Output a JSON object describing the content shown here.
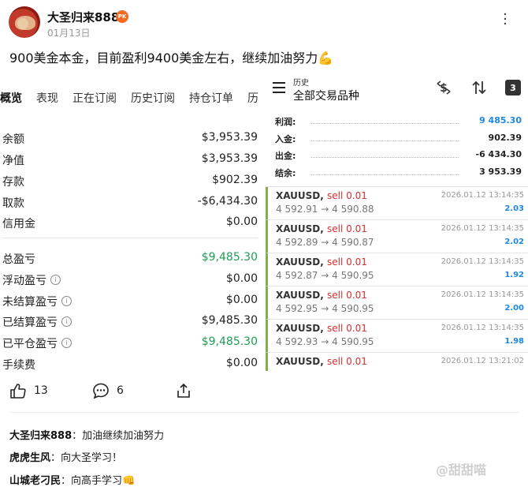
{
  "post": {
    "username": "大圣归来888",
    "badge": "PK",
    "date": "01月13日",
    "caption": "900美金本金，目前盈利9400美金左右，继续加油努力💪"
  },
  "left": {
    "tabs": [
      "概览",
      "表现",
      "正在订阅",
      "历史订阅",
      "持仓订单",
      "历"
    ],
    "rows": [
      {
        "label": "余额",
        "value": "$3,953.39",
        "info": false,
        "green": false
      },
      {
        "label": "净值",
        "value": "$3,953.39",
        "info": false,
        "green": false
      },
      {
        "label": "存款",
        "value": "$902.39",
        "info": false,
        "green": false
      },
      {
        "label": "取款",
        "value": "-$6,434.30",
        "info": false,
        "green": false
      },
      {
        "label": "信用金",
        "value": "$0.00",
        "info": false,
        "green": false
      },
      {
        "label": "总盈亏",
        "value": "$9,485.30",
        "info": false,
        "green": true
      },
      {
        "label": "浮动盈亏",
        "value": "$0.00",
        "info": true,
        "green": false
      },
      {
        "label": "未结算盈亏",
        "value": "$0.00",
        "info": true,
        "green": false
      },
      {
        "label": "已结算盈亏",
        "value": "$9,485.30",
        "info": true,
        "green": false
      },
      {
        "label": "已平仓盈亏",
        "value": "$9,485.30",
        "info": true,
        "green": true
      },
      {
        "label": "手续费",
        "value": "$0.00",
        "info": false,
        "green": false
      }
    ]
  },
  "right": {
    "subtitle": "历史",
    "title": "全部交易品种",
    "calendar_day": "3",
    "summary": [
      {
        "label": "利润:",
        "value": "9 485.30",
        "blue": true
      },
      {
        "label": "入金:",
        "value": "902.39",
        "blue": false
      },
      {
        "label": "出金:",
        "value": "-6 434.30",
        "blue": false
      },
      {
        "label": "结余:",
        "value": "3 953.39",
        "blue": false
      }
    ],
    "trades": [
      {
        "symbol": "XAUUSD,",
        "side": "sell 0.01",
        "prices": "4 592.91 → 4 590.88",
        "time": "2026.01.12 13:14:35",
        "profit": "2.03"
      },
      {
        "symbol": "XAUUSD,",
        "side": "sell 0.01",
        "prices": "4 592.89 → 4 590.87",
        "time": "2026.01.12 13:14:35",
        "profit": "2.02"
      },
      {
        "symbol": "XAUUSD,",
        "side": "sell 0.01",
        "prices": "4 592.87 → 4 590.95",
        "time": "2026.01.12 13:14:35",
        "profit": "1.92"
      },
      {
        "symbol": "XAUUSD,",
        "side": "sell 0.01",
        "prices": "4 592.95 → 4 590.95",
        "time": "2026.01.12 13:14:35",
        "profit": "2.00"
      },
      {
        "symbol": "XAUUSD,",
        "side": "sell 0.01",
        "prices": "4 592.93 → 4 590.95",
        "time": "2026.01.12 13:14:35",
        "profit": "1.98"
      },
      {
        "symbol": "XAUUSD,",
        "side": "sell 0.01",
        "prices": "",
        "time": "2026.01.12 13:21:02",
        "profit": ""
      }
    ]
  },
  "actions": {
    "likes": "13",
    "comments": "6"
  },
  "comments": [
    {
      "user": "大圣归来888",
      "text": "：加油继续加油努力"
    },
    {
      "user": "虎虎生风",
      "text": "：向大圣学习！"
    },
    {
      "user": "山城老刁民",
      "text": "：向高手学习👊"
    }
  ],
  "watermark": "@甜甜喵",
  "colors": {
    "green": "#1f9d55",
    "blue": "#1e88e5",
    "sell": "#d32f2f",
    "trade_bar": "#7cb342",
    "badge": "#f26b21"
  }
}
